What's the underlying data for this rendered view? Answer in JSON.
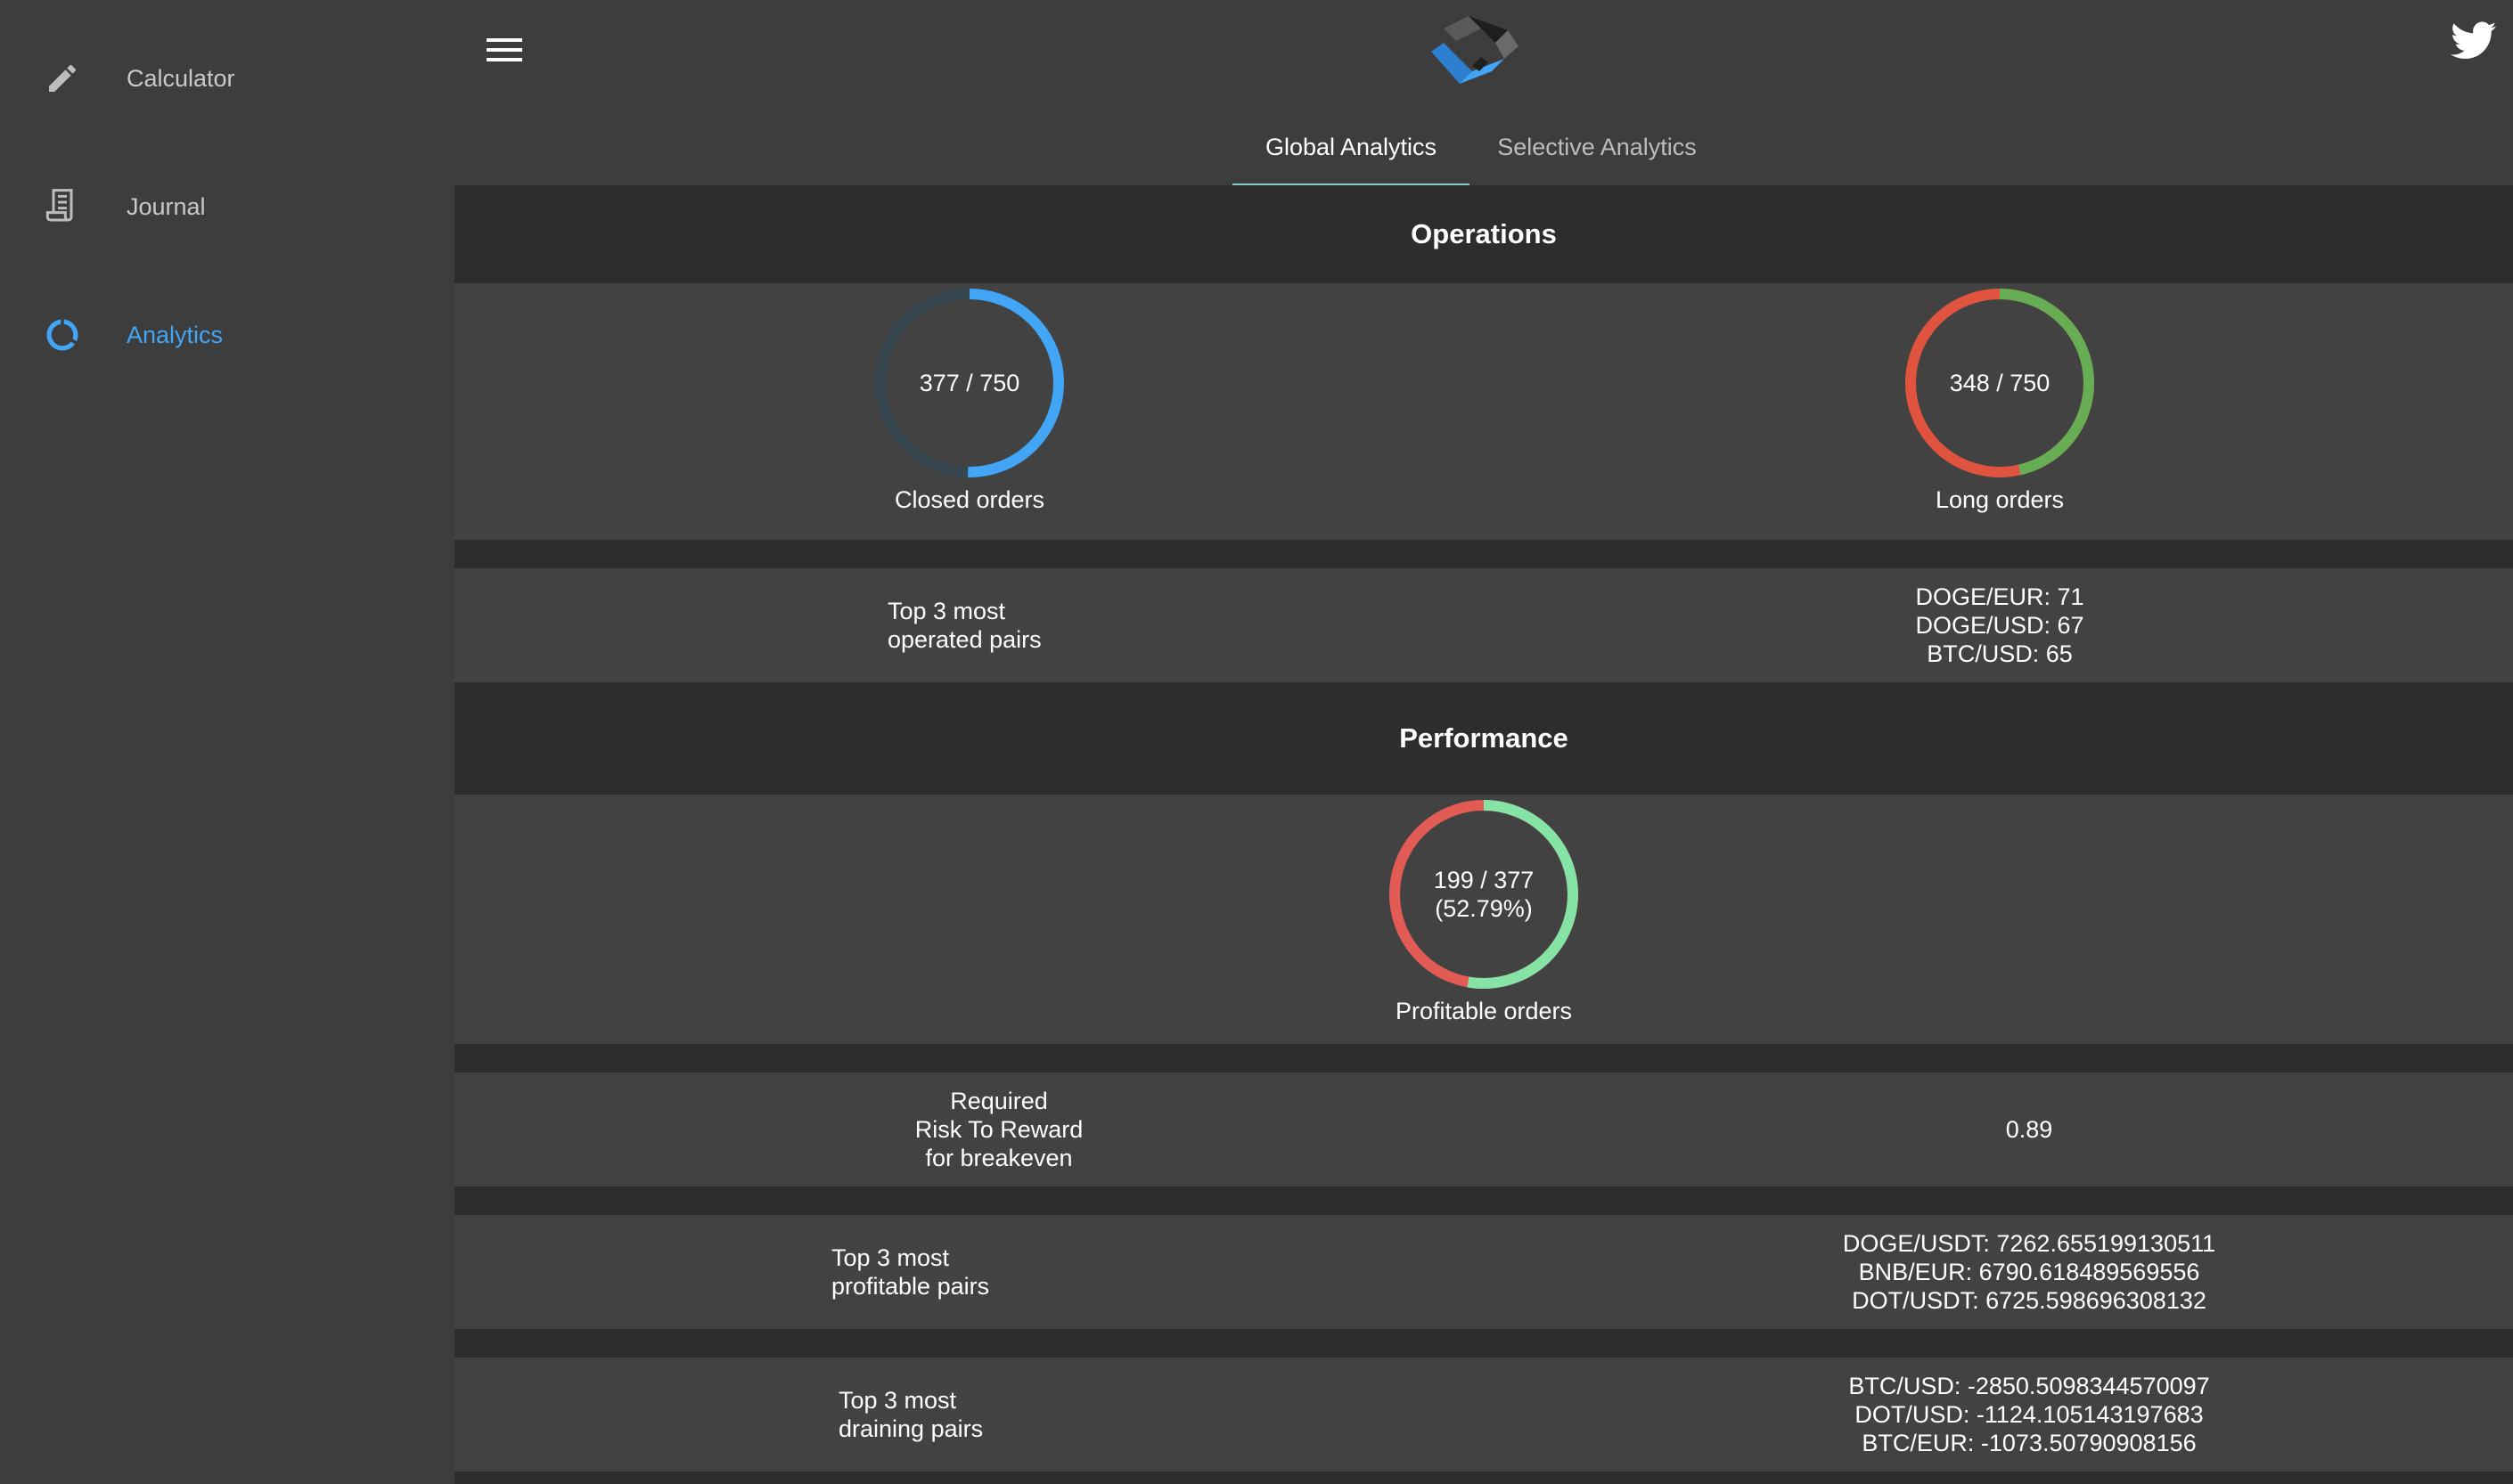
{
  "sidebar": {
    "items": [
      {
        "label": "Calculator",
        "icon": "pencil-icon",
        "active": false
      },
      {
        "label": "Journal",
        "icon": "receipt-icon",
        "active": false
      },
      {
        "label": "Analytics",
        "icon": "donut-icon",
        "active": true
      }
    ]
  },
  "tabs": [
    {
      "label": "Global Analytics",
      "active": true
    },
    {
      "label": "Selective Analytics",
      "active": false
    }
  ],
  "operations": {
    "title": "Operations",
    "closed_orders": {
      "text": "377 / 750",
      "label": "Closed orders",
      "value": 377,
      "total": 750
    },
    "long_orders": {
      "text": "348 / 750",
      "label": "Long orders",
      "value": 348,
      "total": 750
    },
    "top_pairs": {
      "label_line1": "Top 3 most",
      "label_line2": "operated pairs",
      "values": [
        "DOGE/EUR: 71",
        "DOGE/USD: 67",
        "BTC/USD: 65"
      ]
    }
  },
  "performance": {
    "title": "Performance",
    "profitable_orders": {
      "line1": "199 / 377",
      "line2": "(52.79%)",
      "label": "Profitable orders",
      "value": 199,
      "total": 377
    },
    "risk_reward": {
      "label_line1": "Required",
      "label_line2": "Risk To Reward",
      "label_line3": "for breakeven",
      "value": "0.89"
    },
    "profitable_pairs": {
      "label_line1": "Top 3 most",
      "label_line2": "profitable pairs",
      "values": [
        "DOGE/USDT: 7262.655199130511",
        "BNB/EUR: 6790.618489569556",
        "DOT/USDT: 6725.598696308132"
      ]
    },
    "draining_pairs": {
      "label_line1": "Top 3 most",
      "label_line2": "draining pairs",
      "values": [
        "BTC/USD: -2850.5098344570097",
        "DOT/USD: -1124.105143197683",
        "BTC/EUR: -1073.50790908156"
      ]
    }
  },
  "colors": {
    "accent_blue": "#42a5f5",
    "ring_track_blue": "#37474f",
    "red": "#e0533f",
    "green": "#66ad53",
    "light_green": "#86e3a6",
    "tab_indicator": "#80cbc4"
  }
}
